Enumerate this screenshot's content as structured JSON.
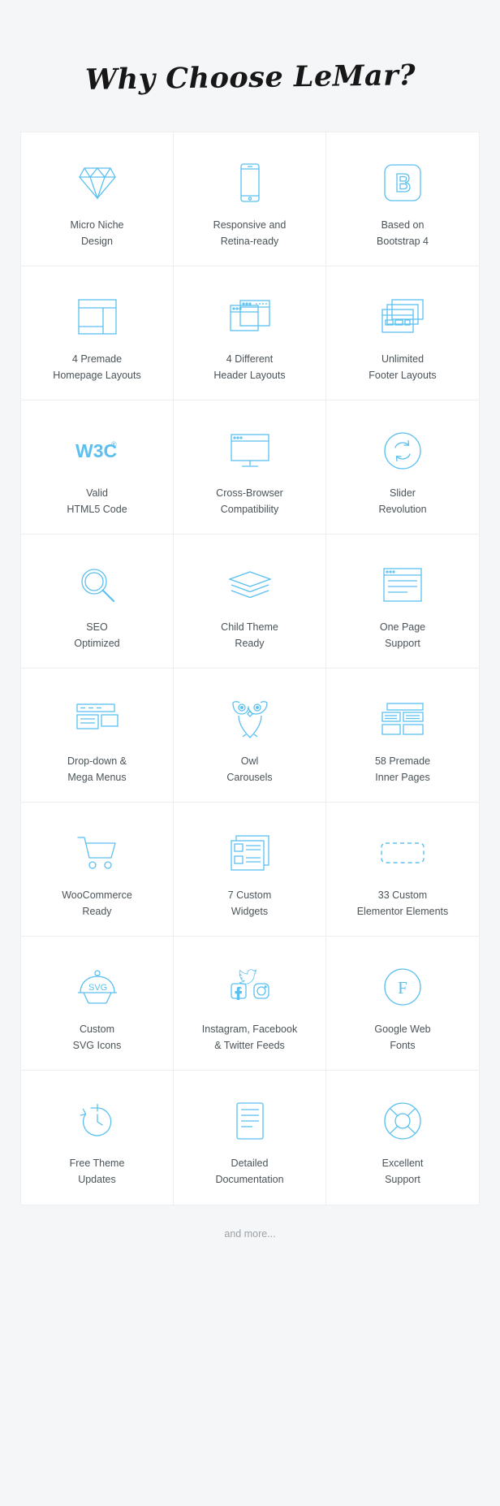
{
  "header": {
    "title": "Why Choose LeMar?"
  },
  "accent_color": "#5bc0f0",
  "text_color": "#4a5358",
  "background_color": "#f5f6f7",
  "card_background": "#ffffff",
  "border_color": "#eceef0",
  "footer": {
    "more_label": "and more..."
  },
  "features": [
    {
      "icon": "diamond-icon",
      "label": "Micro Niche\nDesign"
    },
    {
      "icon": "mobile-phone-icon",
      "label": "Responsive and\nRetina-ready"
    },
    {
      "icon": "bootstrap-b-icon",
      "label": "Based on\nBootstrap 4"
    },
    {
      "icon": "layout-columns-icon",
      "label": "4 Premade\nHomepage Layouts"
    },
    {
      "icon": "browser-windows-icon",
      "label": "4 Different\nHeader Layouts"
    },
    {
      "icon": "stacked-windows-icon",
      "label": "Unlimited\nFooter Layouts"
    },
    {
      "icon": "w3c-icon",
      "label": "Valid\nHTML5 Code"
    },
    {
      "icon": "desktop-monitor-icon",
      "label": "Cross-Browser\nCompatibility"
    },
    {
      "icon": "refresh-circle-icon",
      "label": "Slider\nRevolution"
    },
    {
      "icon": "magnifier-icon",
      "label": "SEO\nOptimized"
    },
    {
      "icon": "layers-icon",
      "label": "Child Theme\nReady"
    },
    {
      "icon": "browser-page-icon",
      "label": "One Page\nSupport"
    },
    {
      "icon": "menu-dropdown-icon",
      "label": "Drop-down &\nMega Menus"
    },
    {
      "icon": "owl-icon",
      "label": "Owl\nCarousels"
    },
    {
      "icon": "pages-grid-icon",
      "label": "58 Premade\nInner Pages"
    },
    {
      "icon": "shopping-cart-icon",
      "label": "WooCommerce\nReady"
    },
    {
      "icon": "widgets-list-icon",
      "label": "7 Custom\nWidgets"
    },
    {
      "icon": "dashed-rect-icon",
      "label": "33 Custom\nElementor Elements"
    },
    {
      "icon": "svg-cloche-icon",
      "label": "Custom\nSVG Icons"
    },
    {
      "icon": "social-feeds-icon",
      "label": "Instagram, Facebook\n& Twitter Feeds"
    },
    {
      "icon": "google-font-f-icon",
      "label": "Google Web\nFonts"
    },
    {
      "icon": "clock-update-icon",
      "label": "Free Theme\nUpdates"
    },
    {
      "icon": "document-tablet-icon",
      "label": "Detailed\nDocumentation"
    },
    {
      "icon": "lifebuoy-icon",
      "label": "Excellent\nSupport"
    }
  ]
}
